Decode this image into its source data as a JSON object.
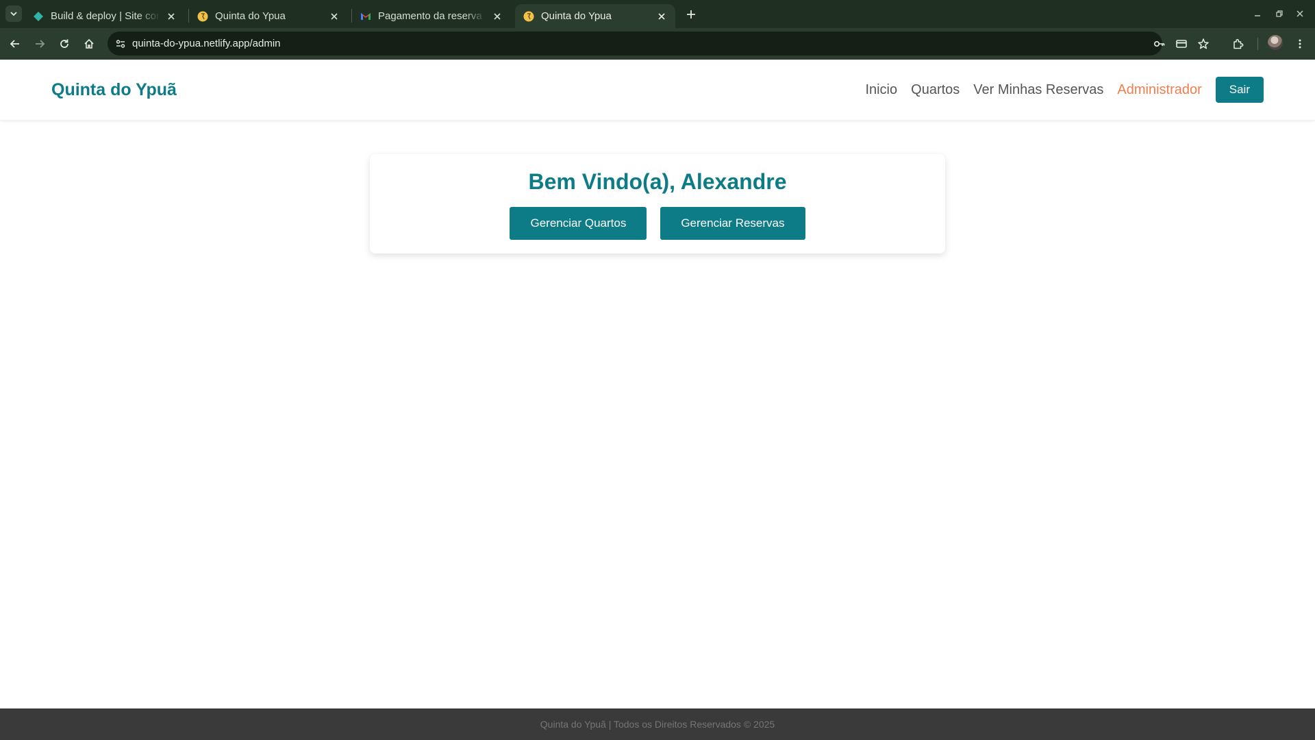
{
  "browser": {
    "tabs": [
      {
        "title": "Build & deploy | Site configuration",
        "favicon": "netlify-icon",
        "active": false
      },
      {
        "title": "Quinta do Ypua",
        "favicon": "site-favicon-icon",
        "active": false
      },
      {
        "title": "Pagamento da reserva recebido",
        "favicon": "gmail-icon",
        "active": false
      },
      {
        "title": "Quinta do Ypua",
        "favicon": "site-favicon-icon",
        "active": true
      }
    ],
    "url": "quinta-do-ypua.netlify.app/admin"
  },
  "header": {
    "logo": "Quinta do Ypuã",
    "nav": {
      "home": "Inicio",
      "rooms": "Quartos",
      "my_reservations": "Ver Minhas Reservas",
      "admin": "Administrador"
    },
    "logout": "Sair"
  },
  "main": {
    "welcome": "Bem Vindo(a), Alexandre",
    "manage_rooms": "Gerenciar Quartos",
    "manage_reservations": "Gerenciar Reservas"
  },
  "footer": {
    "text": "Quinta do Ypuã | Todos os Direitos Reservados © 2025"
  },
  "colors": {
    "brand": "#0e7c86",
    "nav_active": "#f07d4e",
    "chrome_dark": "#1f2f22",
    "footer_bg": "#3a3a3a"
  }
}
